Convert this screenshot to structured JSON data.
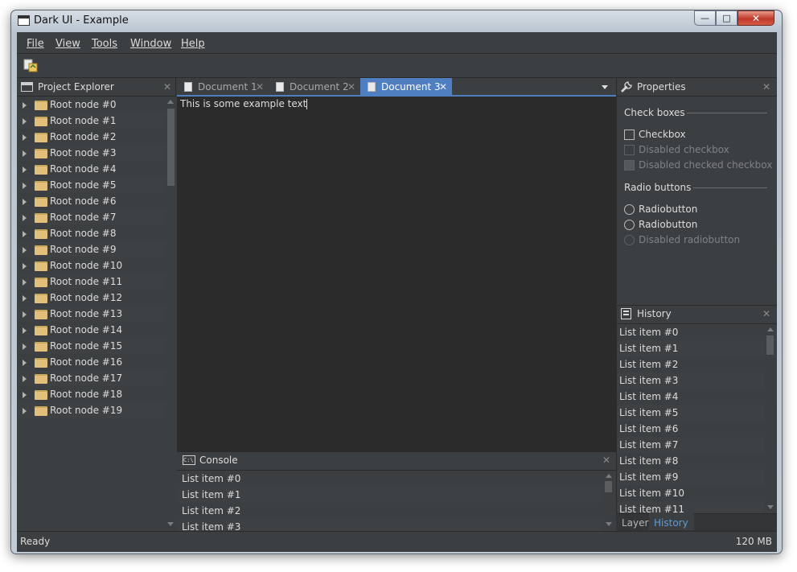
{
  "window": {
    "title": "Dark UI - Example"
  },
  "menu": [
    "File",
    "View",
    "Tools",
    "Window",
    "Help"
  ],
  "project_explorer": {
    "title": "Project Explorer",
    "nodes": [
      "Root node #0",
      "Root node #1",
      "Root node #2",
      "Root node #3",
      "Root node #4",
      "Root node #5",
      "Root node #6",
      "Root node #7",
      "Root node #8",
      "Root node #9",
      "Root node #10",
      "Root node #11",
      "Root node #12",
      "Root node #13",
      "Root node #14",
      "Root node #15",
      "Root node #16",
      "Root node #17",
      "Root node #18",
      "Root node #19"
    ]
  },
  "tabs": [
    {
      "label": "Document 1",
      "active": false
    },
    {
      "label": "Document 2",
      "active": false
    },
    {
      "label": "Document 3",
      "active": true
    }
  ],
  "editor": {
    "text": "This is some example text"
  },
  "console": {
    "title": "Console",
    "items": [
      "List item #0",
      "List item #1",
      "List item #2",
      "List item #3"
    ]
  },
  "properties": {
    "title": "Properties",
    "checkboxes_label": "Check boxes",
    "checkboxes": [
      {
        "label": "Checkbox",
        "state": "enabled"
      },
      {
        "label": "Disabled checkbox",
        "state": "disabled"
      },
      {
        "label": "Disabled checked checkbox",
        "state": "disabled-checked"
      }
    ],
    "radios_label": "Radio buttons",
    "radios": [
      {
        "label": "Radiobutton",
        "state": "enabled"
      },
      {
        "label": "Radiobutton",
        "state": "enabled"
      },
      {
        "label": "Disabled radiobutton",
        "state": "disabled"
      }
    ]
  },
  "history": {
    "title": "History",
    "items": [
      "List item #0",
      "List item #1",
      "List item #2",
      "List item #3",
      "List item #4",
      "List item #5",
      "List item #6",
      "List item #7",
      "List item #8",
      "List item #9",
      "List item #10",
      "List item #11"
    ]
  },
  "bottom_tabs": [
    {
      "label": "Layers",
      "active": false
    },
    {
      "label": "History",
      "active": true
    }
  ],
  "status": {
    "left": "Ready",
    "right": "120 MB"
  },
  "colors": {
    "background": "#3c3f41",
    "editor": "#2b2b2b",
    "accent": "#4f7fc1"
  },
  "icons": {
    "close": "close-icon",
    "menu": "dropdown-arrow-icon"
  }
}
